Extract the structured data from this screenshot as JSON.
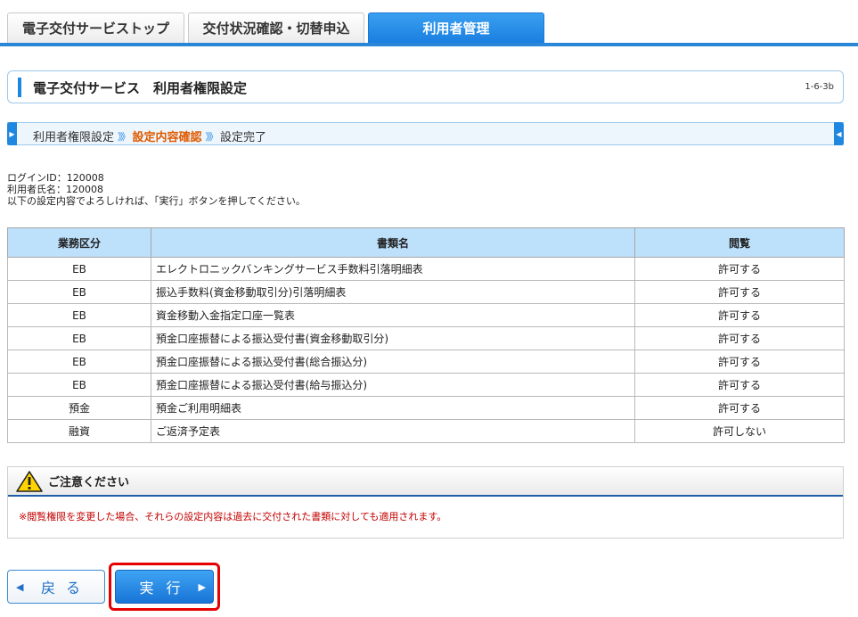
{
  "tabs": [
    {
      "label": "電子交付サービストップ"
    },
    {
      "label": "交付状況確認・切替申込"
    },
    {
      "label": "利用者管理"
    }
  ],
  "header": {
    "title": "電子交付サービス　利用者権限設定",
    "code": "1-6-3b"
  },
  "steps": {
    "items": [
      "利用者権限設定",
      "設定内容確認",
      "設定完了"
    ],
    "arrow": "》》",
    "current_index": 1
  },
  "info": {
    "login_id": "ログインID：120008",
    "user_name": "利用者氏名：120008",
    "instruction": "以下の設定内容でよろしければ、「実行」ボタンを押してください。"
  },
  "table": {
    "headers": [
      "業務区分",
      "書類名",
      "閲覧"
    ],
    "rows": [
      [
        "EB",
        "エレクトロニックバンキングサービス手数料引落明細表",
        "許可する"
      ],
      [
        "EB",
        "振込手数料(資金移動取引分)引落明細表",
        "許可する"
      ],
      [
        "EB",
        "資金移動入金指定口座一覧表",
        "許可する"
      ],
      [
        "EB",
        "預金口座振替による振込受付書(資金移動取引分)",
        "許可する"
      ],
      [
        "EB",
        "預金口座振替による振込受付書(総合振込分)",
        "許可する"
      ],
      [
        "EB",
        "預金口座振替による振込受付書(給与振込分)",
        "許可する"
      ],
      [
        "預金",
        "預金ご利用明細表",
        "許可する"
      ],
      [
        "融資",
        "ご返済予定表",
        "許可しない"
      ]
    ]
  },
  "notice": {
    "title": "ご注意ください",
    "message": "※閲覧権限を変更した場合、それらの設定内容は過去に交付された書類に対しても適用されます。",
    "icon": "warning-icon"
  },
  "buttons": {
    "back_label": "戻る",
    "execute_label": "実行"
  },
  "colors": {
    "accent": "#1f87e0",
    "current_step": "#e05a00",
    "notice_text": "#c40000",
    "highlight": "#e60000"
  }
}
